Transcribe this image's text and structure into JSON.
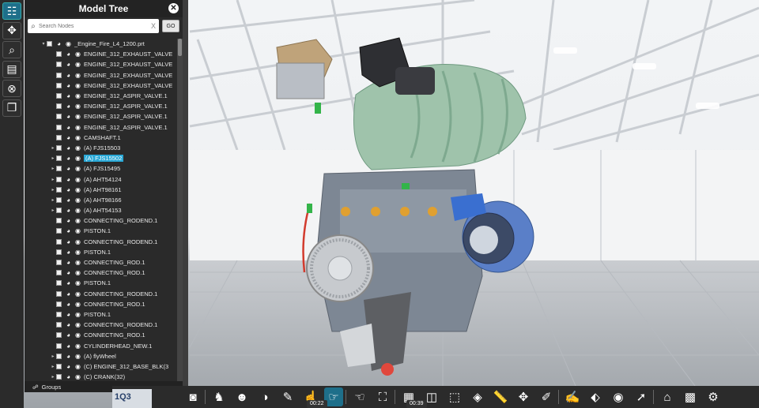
{
  "tree": {
    "title": "Model Tree",
    "search_placeholder": "Search Nodes",
    "search_clear": "X",
    "go_label": "GO",
    "groups_label": "Groups",
    "rows": [
      {
        "label": "_Engine_Fire_L4_1200.prt",
        "indent": 1,
        "expander": "▾",
        "selected": false
      },
      {
        "label": "ENGINE_312_EXHAUST_VALVE",
        "indent": 2,
        "expander": "",
        "selected": false
      },
      {
        "label": "ENGINE_312_EXHAUST_VALVE",
        "indent": 2,
        "expander": "",
        "selected": false
      },
      {
        "label": "ENGINE_312_EXHAUST_VALVE",
        "indent": 2,
        "expander": "",
        "selected": false
      },
      {
        "label": "ENGINE_312_EXHAUST_VALVE",
        "indent": 2,
        "expander": "",
        "selected": false
      },
      {
        "label": "ENGINE_312_ASPIR_VALVE.1",
        "indent": 2,
        "expander": "",
        "selected": false
      },
      {
        "label": "ENGINE_312_ASPIR_VALVE.1",
        "indent": 2,
        "expander": "",
        "selected": false
      },
      {
        "label": "ENGINE_312_ASPIR_VALVE.1",
        "indent": 2,
        "expander": "",
        "selected": false
      },
      {
        "label": "ENGINE_312_ASPIR_VALVE.1",
        "indent": 2,
        "expander": "",
        "selected": false
      },
      {
        "label": "CAMSHAFT.1",
        "indent": 2,
        "expander": "",
        "selected": false
      },
      {
        "label": "(A) FJS15503",
        "indent": 2,
        "expander": "▸",
        "selected": false
      },
      {
        "label": "(A) FJS15502",
        "indent": 2,
        "expander": "▸",
        "selected": true
      },
      {
        "label": "(A) FJS15495",
        "indent": 2,
        "expander": "▸",
        "selected": false
      },
      {
        "label": "(A) AHT54124",
        "indent": 2,
        "expander": "▸",
        "selected": false
      },
      {
        "label": "(A) AHT98161",
        "indent": 2,
        "expander": "▸",
        "selected": false
      },
      {
        "label": "(A) AHT98166",
        "indent": 2,
        "expander": "▸",
        "selected": false
      },
      {
        "label": "(A) AHT54153",
        "indent": 2,
        "expander": "▸",
        "selected": false
      },
      {
        "label": "CONNECTING_RODEND.1",
        "indent": 2,
        "expander": "",
        "selected": false
      },
      {
        "label": "PISTON.1",
        "indent": 2,
        "expander": "",
        "selected": false
      },
      {
        "label": "CONNECTING_RODEND.1",
        "indent": 2,
        "expander": "",
        "selected": false
      },
      {
        "label": "PISTON.1",
        "indent": 2,
        "expander": "",
        "selected": false
      },
      {
        "label": "CONNECTING_ROD.1",
        "indent": 2,
        "expander": "",
        "selected": false
      },
      {
        "label": "CONNECTING_ROD.1",
        "indent": 2,
        "expander": "",
        "selected": false
      },
      {
        "label": "PISTON.1",
        "indent": 2,
        "expander": "",
        "selected": false
      },
      {
        "label": "CONNECTING_RODEND.1",
        "indent": 2,
        "expander": "",
        "selected": false
      },
      {
        "label": "CONNECTING_ROD.1",
        "indent": 2,
        "expander": "",
        "selected": false
      },
      {
        "label": "PISTON.1",
        "indent": 2,
        "expander": "",
        "selected": false
      },
      {
        "label": "CONNECTING_RODEND.1",
        "indent": 2,
        "expander": "",
        "selected": false
      },
      {
        "label": "CONNECTING_ROD.1",
        "indent": 2,
        "expander": "",
        "selected": false
      },
      {
        "label": "CYLINDERHEAD_NEW.1",
        "indent": 2,
        "expander": "",
        "selected": false
      },
      {
        "label": "(A) flyWheel",
        "indent": 2,
        "expander": "▸",
        "selected": false
      },
      {
        "label": "(C) ENGINE_312_BASE_BLK(3",
        "indent": 2,
        "expander": "▸",
        "selected": false
      },
      {
        "label": "(C) CRANK(32)",
        "indent": 2,
        "expander": "▸",
        "selected": false
      }
    ]
  },
  "left_toolbar": [
    {
      "name": "model-tree-icon",
      "glyph": "☷",
      "active": true
    },
    {
      "name": "move-icon",
      "glyph": "✥",
      "active": false
    },
    {
      "name": "search-icon",
      "glyph": "⌕",
      "active": false
    },
    {
      "name": "info-icon",
      "glyph": "▤",
      "active": false
    },
    {
      "name": "close-all-icon",
      "glyph": "⊗",
      "active": false
    },
    {
      "name": "pages-icon",
      "glyph": "❐",
      "active": false
    }
  ],
  "bottom_toolbar": [
    {
      "name": "vr-icon",
      "glyph": "◙",
      "active": false
    },
    {
      "name": "walk-icon",
      "glyph": "♞",
      "active": false
    },
    {
      "name": "users-icon",
      "glyph": "☻",
      "active": false
    },
    {
      "name": "view-person-icon",
      "glyph": "◑",
      "active": false
    },
    {
      "name": "comment-icon",
      "glyph": "✎",
      "active": false
    },
    {
      "name": "hand-icon",
      "glyph": "☝",
      "active": false
    },
    {
      "name": "pointer-touch-icon",
      "glyph": "☞",
      "active": true
    },
    {
      "name": "select-touch-icon",
      "glyph": "☜",
      "active": false
    },
    {
      "name": "fit-icon",
      "glyph": "⛶",
      "active": false
    },
    {
      "name": "section-icon",
      "glyph": "▦",
      "active": false
    },
    {
      "name": "cube-icon",
      "glyph": "◫",
      "active": false
    },
    {
      "name": "cube-outline-icon",
      "glyph": "⬚",
      "active": false
    },
    {
      "name": "explode-icon",
      "glyph": "◈",
      "active": false
    },
    {
      "name": "measure-icon",
      "glyph": "📏",
      "active": false
    },
    {
      "name": "transform-icon",
      "glyph": "✥",
      "active": false
    },
    {
      "name": "paint-icon",
      "glyph": "✐",
      "active": false
    },
    {
      "name": "markup-icon",
      "glyph": "✍",
      "active": false
    },
    {
      "name": "tag-icon",
      "glyph": "⬖",
      "active": false
    },
    {
      "name": "camera-icon",
      "glyph": "◉",
      "active": false
    },
    {
      "name": "select-cursor-icon",
      "glyph": "➚",
      "active": false
    },
    {
      "name": "home-icon",
      "glyph": "⌂",
      "active": false
    },
    {
      "name": "grid-icon",
      "glyph": "▩",
      "active": false
    },
    {
      "name": "settings-icon",
      "glyph": "⚙",
      "active": false
    }
  ],
  "time_markers": {
    "left": "00:22",
    "right": "00:39"
  },
  "logo_text": "1Q3",
  "colors": {
    "accent": "#29a8d6",
    "panel": "#2a2a2a"
  }
}
